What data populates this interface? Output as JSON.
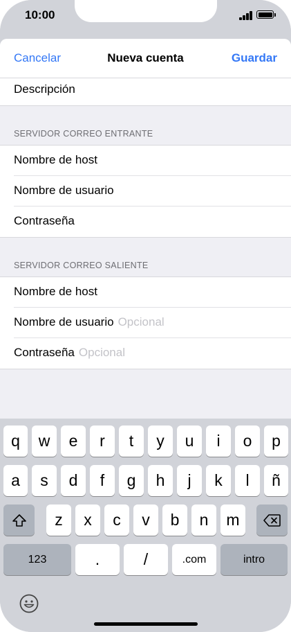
{
  "status": {
    "time": "10:00"
  },
  "nav": {
    "cancel": "Cancelar",
    "title": "Nueva cuenta",
    "save": "Guardar"
  },
  "form": {
    "description_label": "Descripción",
    "incoming": {
      "header": "SERVIDOR CORREO ENTRANTE",
      "host_label": "Nombre de host",
      "user_label": "Nombre de usuario",
      "password_label": "Contraseña"
    },
    "outgoing": {
      "header": "SERVIDOR CORREO SALIENTE",
      "host_label": "Nombre de host",
      "user_label": "Nombre de usuario",
      "user_placeholder": "Opcional",
      "password_label": "Contraseña",
      "password_placeholder": "Opcional"
    }
  },
  "keyboard": {
    "row1": [
      "q",
      "w",
      "e",
      "r",
      "t",
      "y",
      "u",
      "i",
      "o",
      "p"
    ],
    "row2": [
      "a",
      "s",
      "d",
      "f",
      "g",
      "h",
      "j",
      "k",
      "l",
      "ñ"
    ],
    "row3": [
      "z",
      "x",
      "c",
      "v",
      "b",
      "n",
      "m"
    ],
    "numbers_key": "123",
    "dot_key": ".",
    "slash_key": "/",
    "dotcom_key": ".com",
    "return_key": "intro"
  },
  "colors": {
    "accent": "#3478f6",
    "keyboard_bg": "#d1d3d9",
    "placeholder": "#c3c3c8"
  }
}
